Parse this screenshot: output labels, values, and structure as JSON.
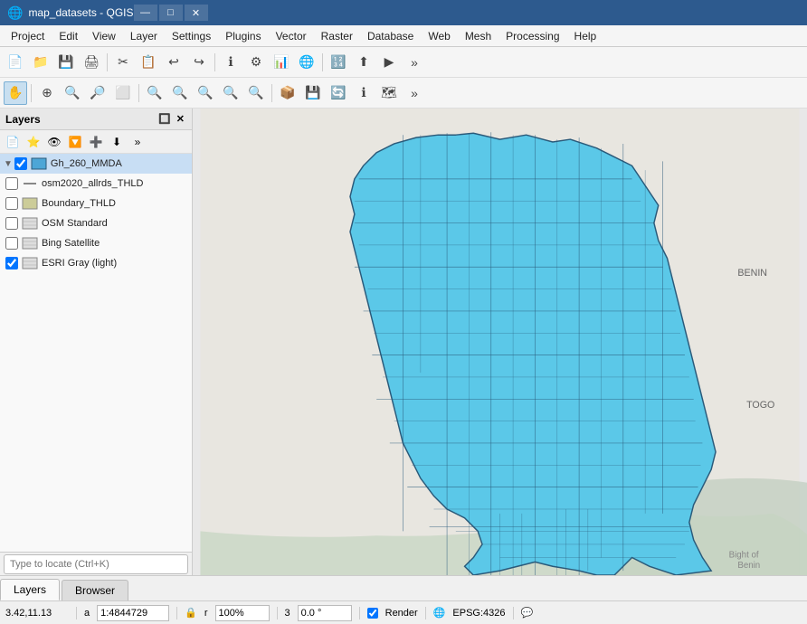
{
  "window": {
    "title": "map_datasets - QGIS",
    "icon": "🌐"
  },
  "window_controls": {
    "minimize": "—",
    "maximize": "□",
    "close": "✕"
  },
  "menu": {
    "items": [
      "Project",
      "Edit",
      "View",
      "Layer",
      "Settings",
      "Plugins",
      "Vector",
      "Raster",
      "Database",
      "Web",
      "Mesh",
      "Processing",
      "Help"
    ]
  },
  "toolbar1": {
    "tools": [
      "📄",
      "📁",
      "💾",
      "💾",
      "🖨",
      "✂",
      "📋",
      "📋",
      "↩",
      "↪",
      "🔍",
      "ℹ",
      "⚙",
      "📊",
      "🌐",
      "🔢",
      "⬆",
      "▶",
      "🔧",
      "»"
    ]
  },
  "toolbar2": {
    "tools": [
      "✋",
      "⊕",
      "🔍",
      "🔍",
      "⬜",
      "🔍",
      "🔍",
      "🔍",
      "🔍",
      "🔍",
      "🔍",
      "🔍",
      "📦",
      "💾",
      "🔄",
      "ℹ",
      "🔍",
      "🗺",
      "»"
    ]
  },
  "layers_panel": {
    "title": "Layers",
    "toolbar_icons": [
      "📄",
      "⭐",
      "👁",
      "🔽",
      "➕",
      "⬇",
      "»"
    ],
    "header_icons": [
      "🔲",
      "✕"
    ],
    "layers": [
      {
        "id": "gh260",
        "checked": true,
        "expanded": true,
        "name": "Gh_260_MMDA",
        "icon_type": "polygon",
        "icon_color": "#4da6d6",
        "selected": true
      },
      {
        "id": "osm2020",
        "checked": false,
        "expanded": false,
        "name": "osm2020_allrds_THLD",
        "icon_type": "line",
        "icon_color": "#888888",
        "selected": false
      },
      {
        "id": "boundary",
        "checked": false,
        "expanded": false,
        "name": "Boundary_THLD",
        "icon_type": "polygon_outline",
        "icon_color": "#cccc99",
        "selected": false
      },
      {
        "id": "osm_standard",
        "checked": false,
        "expanded": false,
        "name": "OSM Standard",
        "icon_type": "tile",
        "icon_color": "#888888",
        "selected": false
      },
      {
        "id": "bing",
        "checked": false,
        "expanded": false,
        "name": "Bing Satellite",
        "icon_type": "tile",
        "icon_color": "#888888",
        "selected": false
      },
      {
        "id": "esri",
        "checked": true,
        "expanded": false,
        "name": "ESRI Gray (light)",
        "icon_type": "tile",
        "icon_color": "#888888",
        "selected": false
      }
    ]
  },
  "bottom_tabs": [
    {
      "id": "layers",
      "label": "Layers",
      "active": true
    },
    {
      "id": "browser",
      "label": "Browser",
      "active": false
    }
  ],
  "status_bar": {
    "coordinates": "3.42,11.13",
    "scale_label": "a",
    "scale_value": "1:4844729",
    "lock_icon": "🔒",
    "zoom_label": "r",
    "zoom_value": "100%",
    "rotation_label": "3",
    "rotation_value": "0.0 °",
    "render_checkbox": true,
    "render_label": "Render",
    "crs_icon": "🌐",
    "crs_value": "EPSG:4326",
    "messages_icon": "💬"
  },
  "locate_bar": {
    "placeholder": "Type to locate (Ctrl+K)"
  },
  "map": {
    "background_color": "#e8e8e0",
    "water_color": "#ccd5cc",
    "ghana_fill": "#5bc8e8",
    "ghana_stroke": "#2a5a7a",
    "label_benin": "BENIN",
    "label_togo": "TOGO",
    "label_bight": "Bight of\nBenin"
  }
}
